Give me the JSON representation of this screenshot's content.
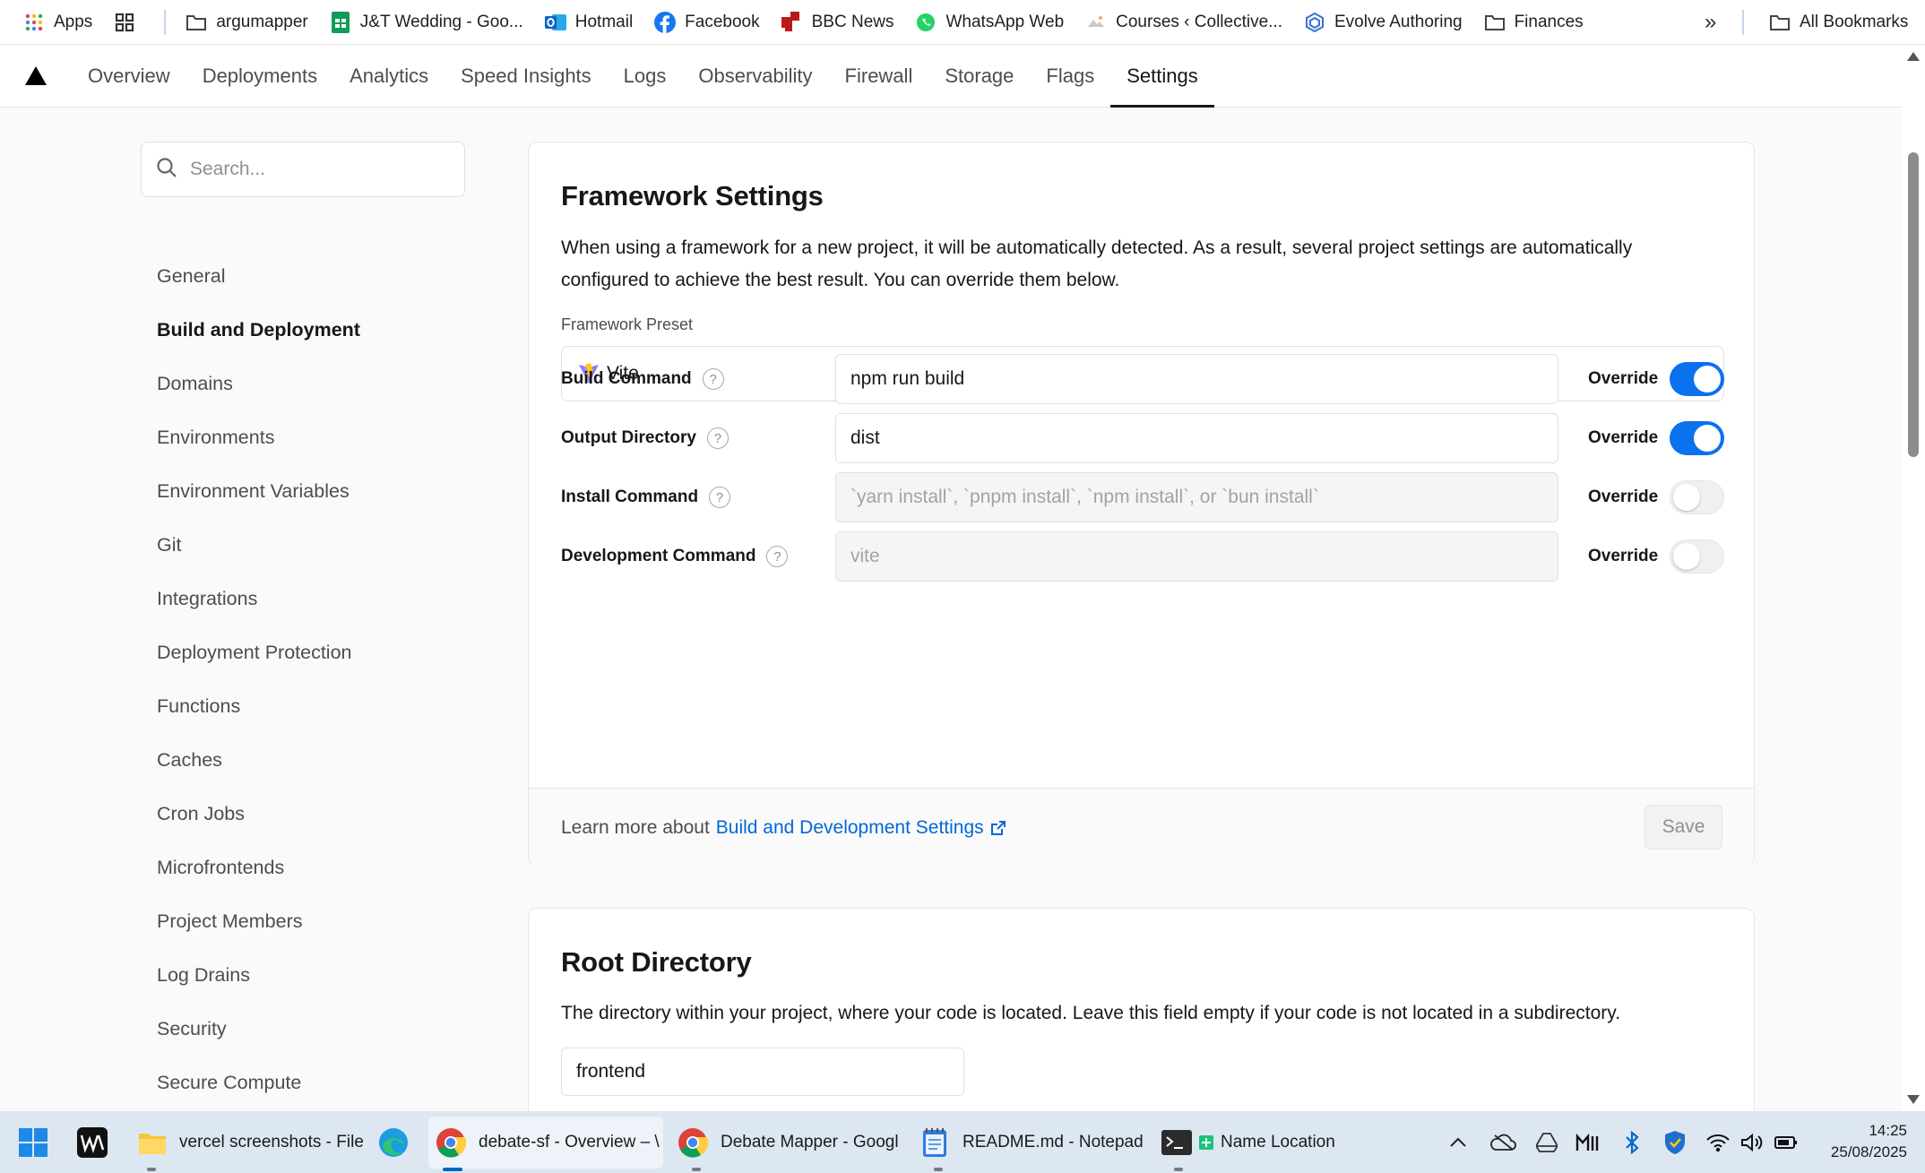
{
  "bookmarks": {
    "items": [
      {
        "label": "Apps",
        "icon": "apps-grid-icon",
        "color": "#e8453c"
      },
      {
        "label": "",
        "icon": "tab-groups-icon",
        "color": "#333333"
      },
      {
        "label": "argumapper",
        "icon": "folder-icon",
        "color": "#444444"
      },
      {
        "label": "J&T Wedding - Goo...",
        "icon": "google-sheets-icon",
        "color": "#0f9d58"
      },
      {
        "label": "Hotmail",
        "icon": "outlook-icon",
        "color": "#0a64c9"
      },
      {
        "label": "Facebook",
        "icon": "facebook-icon",
        "color": "#1877f2"
      },
      {
        "label": "BBC News",
        "icon": "bbc-news-icon",
        "color": "#bb1919"
      },
      {
        "label": "WhatsApp Web",
        "icon": "whatsapp-icon",
        "color": "#25d366"
      },
      {
        "label": "Courses ‹ Collective...",
        "icon": "collective-icon",
        "color": "#999999"
      },
      {
        "label": "Evolve Authoring",
        "icon": "evolve-icon",
        "color": "#3b6fd6"
      },
      {
        "label": "Finances",
        "icon": "folder-icon",
        "color": "#444444"
      }
    ],
    "more_label": "»",
    "all_bookmarks": "All Bookmarks"
  },
  "nav": {
    "tabs": [
      "Overview",
      "Deployments",
      "Analytics",
      "Speed Insights",
      "Logs",
      "Observability",
      "Firewall",
      "Storage",
      "Flags",
      "Settings"
    ],
    "active_tab": "Settings"
  },
  "sidebar": {
    "search_placeholder": "Search...",
    "items": [
      "General",
      "Build and Deployment",
      "Domains",
      "Environments",
      "Environment Variables",
      "Git",
      "Integrations",
      "Deployment Protection",
      "Functions",
      "Caches",
      "Cron Jobs",
      "Microfrontends",
      "Project Members",
      "Log Drains",
      "Security",
      "Secure Compute"
    ],
    "active_item": "Build and Deployment"
  },
  "framework": {
    "title": "Framework Settings",
    "description_line1": "When using a framework for a new project, it will be automatically detected. As a result, several project settings are automatically",
    "description_line2": "configured to achieve the best result. You can override them below.",
    "preset_label": "Framework Preset",
    "preset_value": "Vite",
    "rows": [
      {
        "label": "Build Command",
        "value": "npm run build",
        "placeholder": "",
        "override_label": "Override",
        "override": true
      },
      {
        "label": "Output Directory",
        "value": "dist",
        "placeholder": "",
        "override_label": "Override",
        "override": true
      },
      {
        "label": "Install Command",
        "value": "",
        "placeholder": "`yarn install`, `pnpm install`, `npm install`, or `bun install`",
        "override_label": "Override",
        "override": false
      },
      {
        "label": "Development Command",
        "value": "",
        "placeholder": "vite",
        "override_label": "Override",
        "override": false
      }
    ],
    "help_glyph": "?",
    "footer_prefix": "Learn more about",
    "footer_link": "Build and Development Settings",
    "save_label": "Save"
  },
  "root": {
    "title": "Root Directory",
    "description": "The directory within your project, where your code is located. Leave this field empty if your code is not located in a subdirectory.",
    "value": "frontend"
  },
  "taskbar": {
    "apps": [
      {
        "label": "vercel screenshots - File",
        "icon": "file-explorer-icon"
      },
      {
        "label": "debate-sf - Overview – \\",
        "icon": "chrome-icon"
      },
      {
        "label": "Debate Mapper - Googl",
        "icon": "chrome-icon"
      },
      {
        "label": "README.md - Notepad",
        "icon": "notepad-icon"
      },
      {
        "label": "Name Location",
        "icon": "terminal-icon"
      }
    ],
    "time": "14:25",
    "date": "25/08/2025"
  },
  "colors": {
    "accent": "#0a72ef",
    "link": "#0068d6",
    "text": "#171717",
    "muted": "#4d4d4d"
  }
}
